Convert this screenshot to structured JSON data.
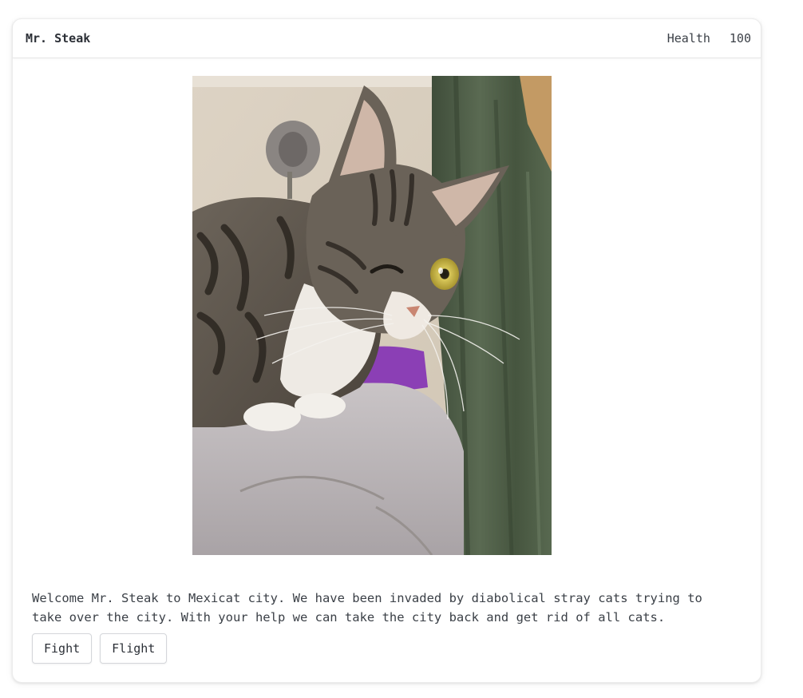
{
  "header": {
    "player_name": "Mr. Steak",
    "health_label": "Health",
    "health_value": "100"
  },
  "scene": {
    "image_subject": "tabby-cat-photo"
  },
  "message": "Welcome Mr. Steak to Mexicat city. We have been invaded by diabolical stray cats trying to take over the city. With your help we can take the city back and get rid of all cats.",
  "actions": {
    "fight_label": "Fight",
    "flight_label": "Flight"
  }
}
